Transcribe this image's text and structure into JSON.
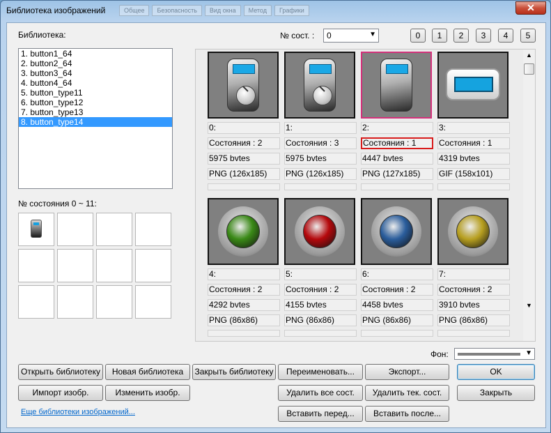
{
  "window": {
    "title": "Библиотека изображений",
    "close_glyph": "✕",
    "ghost_tabs": [
      "Общее",
      "Безопасность",
      "Вид окна",
      "Метод",
      "Графики"
    ]
  },
  "library": {
    "label": "Библиотека:",
    "items": [
      "1. button1_64",
      "2. button2_64",
      "3. button3_64",
      "4. button4_64",
      "5. button_type11",
      "6. button_type12",
      "7. button_type13",
      "8. button_type14"
    ],
    "selected_index": 7
  },
  "state_selector": {
    "label": "№ сост. :",
    "value": "0",
    "buttons": [
      "0",
      "1",
      "2",
      "3",
      "4",
      "5"
    ]
  },
  "states_grid": {
    "label": "№ состояния 0 ~ 11:",
    "cells": 12
  },
  "gallery": {
    "tiles": [
      {
        "index": "0:",
        "states": "Состояния : 2",
        "size": "5975 bvtes",
        "format": "PNG (126x185)",
        "kind": "device-knob",
        "selected": false
      },
      {
        "index": "1:",
        "states": "Состояния : 3",
        "size": "5975 bvtes",
        "format": "PNG (126x185)",
        "kind": "device-knob",
        "selected": false
      },
      {
        "index": "2:",
        "states": "Состояния : 1",
        "size": "4447 bvtes",
        "format": "PNG (127x185)",
        "kind": "device-plain",
        "selected": true
      },
      {
        "index": "3:",
        "states": "Состояния : 1",
        "size": "4319 bvtes",
        "format": "GIF (158x101)",
        "kind": "panel",
        "selected": false
      },
      {
        "index": "4:",
        "states": "Состояния : 2",
        "size": "4292 bvtes",
        "format": "PNG (86x86)",
        "kind": "ball",
        "color": "#3a8a16",
        "selected": false
      },
      {
        "index": "5:",
        "states": "Состояния : 2",
        "size": "4155 bvtes",
        "format": "PNG (86x86)",
        "kind": "ball",
        "color": "#b5080c",
        "selected": false
      },
      {
        "index": "6:",
        "states": "Состояния : 2",
        "size": "4458 bvtes",
        "format": "PNG (86x86)",
        "kind": "ball",
        "color": "#2a5d9c",
        "selected": false
      },
      {
        "index": "7:",
        "states": "Состояния : 2",
        "size": "3910 bvtes",
        "format": "PNG (86x86)",
        "kind": "ball",
        "color": "#b8a020",
        "selected": false
      }
    ]
  },
  "background": {
    "label": "Фон:",
    "arrow": "▼"
  },
  "buttons": {
    "open_library": "Открыть библиотеку",
    "new_library": "Новая библиотека",
    "close_library": "Закрыть библиотеку",
    "rename": "Переименовать...",
    "export": "Экспорт...",
    "ok": "OK",
    "import_image": "Импорт изобр.",
    "edit_image": "Изменить изобр.",
    "delete_all_states": "Удалить все сост.",
    "delete_current_state": "Удалить тек. сост.",
    "close": "Закрыть",
    "insert_before": "Вставить перед...",
    "insert_after": "Вставить после..."
  },
  "more_link": "Еще библиотеки изображений...",
  "scroll": {
    "up": "▲",
    "down": "▼"
  }
}
